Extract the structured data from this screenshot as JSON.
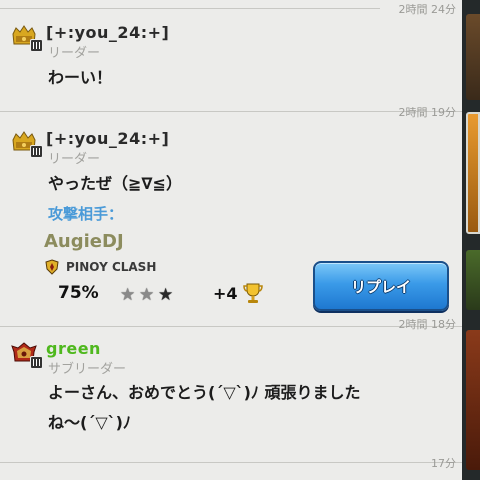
{
  "messages": [
    {
      "time": "2時間 24分",
      "name": "[+:you_24:+]",
      "role": "リーダー",
      "text": "わーい！"
    },
    {
      "time": "2時間 19分",
      "name": "[+:you_24:+]",
      "role": "リーダー",
      "text": "やったぜ（≧∇≦）",
      "attack": {
        "label": "攻撃相手：",
        "opponent": "AugieDJ",
        "clan": "PINOY CLASH",
        "percent": "75%",
        "stars": 2,
        "max_stars": 3,
        "trophies": "+4",
        "replay_label": "リプレイ"
      }
    },
    {
      "time": "2時間 18分",
      "name": "green",
      "role": "サブリーダー",
      "text_line1": "よーさん、おめでとう(´▽`)ﾉ 頑張りました",
      "text_line2": "ね〜(´▽`)ﾉ"
    },
    {
      "time": "17分"
    }
  ],
  "colors": {
    "leader_name": "#2a2a2a",
    "co_leader_name": "#4fb81e",
    "attack_label": "#4a9ad8",
    "replay_button": "#3a9ae8"
  },
  "icons": {
    "leader_badge": "gold-helmet-icon",
    "co_leader_badge": "red-helmet-icon",
    "rank": "rank-bars-icon",
    "clan": "clan-shield-icon",
    "trophy": "trophy-icon",
    "star": "star-icon"
  }
}
